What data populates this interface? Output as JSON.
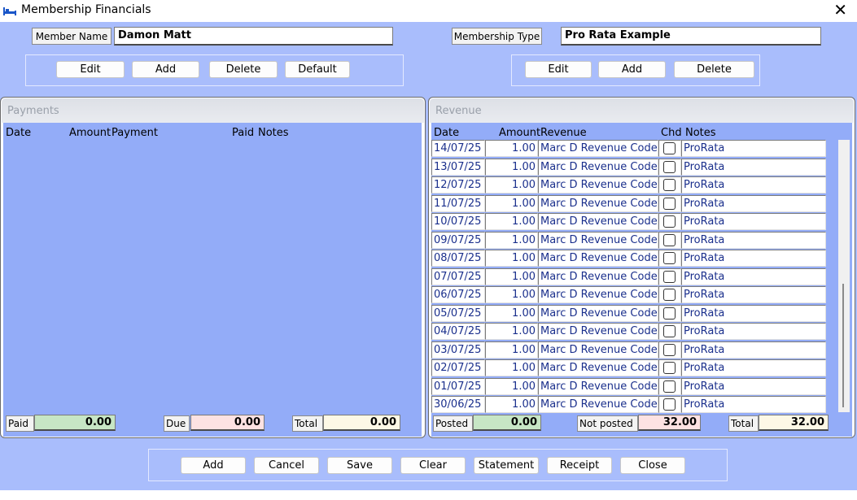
{
  "window": {
    "title": "Membership Financials",
    "icon": "bed-icon",
    "close_glyph": "✕"
  },
  "member": {
    "label": "Member Name",
    "value": "Damon Matt"
  },
  "membership_type": {
    "label": "Membership Type",
    "value": "Pro Rata Example"
  },
  "member_buttons": [
    "Edit",
    "Add",
    "Delete",
    "Default"
  ],
  "type_buttons": [
    "Edit",
    "Add",
    "Delete"
  ],
  "payments": {
    "title": "Payments",
    "columns": [
      "Date",
      "Amount",
      "Payment",
      "Paid",
      "Notes"
    ],
    "totals": {
      "paid_label": "Paid",
      "paid_value": "0.00",
      "due_label": "Due",
      "due_value": "0.00",
      "total_label": "Total",
      "total_value": "0.00"
    }
  },
  "revenue": {
    "title": "Revenue",
    "columns": [
      "Date",
      "Amount",
      "Revenue",
      "Chd",
      "Notes"
    ],
    "rows": [
      {
        "date": "14/07/25",
        "amount": "1.00",
        "revenue": "Marc D Revenue Code",
        "notes": "ProRata"
      },
      {
        "date": "13/07/25",
        "amount": "1.00",
        "revenue": "Marc D Revenue Code",
        "notes": "ProRata"
      },
      {
        "date": "12/07/25",
        "amount": "1.00",
        "revenue": "Marc D Revenue Code",
        "notes": "ProRata"
      },
      {
        "date": "11/07/25",
        "amount": "1.00",
        "revenue": "Marc D Revenue Code",
        "notes": "ProRata"
      },
      {
        "date": "10/07/25",
        "amount": "1.00",
        "revenue": "Marc D Revenue Code",
        "notes": "ProRata"
      },
      {
        "date": "09/07/25",
        "amount": "1.00",
        "revenue": "Marc D Revenue Code",
        "notes": "ProRata"
      },
      {
        "date": "08/07/25",
        "amount": "1.00",
        "revenue": "Marc D Revenue Code",
        "notes": "ProRata"
      },
      {
        "date": "07/07/25",
        "amount": "1.00",
        "revenue": "Marc D Revenue Code",
        "notes": "ProRata"
      },
      {
        "date": "06/07/25",
        "amount": "1.00",
        "revenue": "Marc D Revenue Code",
        "notes": "ProRata"
      },
      {
        "date": "05/07/25",
        "amount": "1.00",
        "revenue": "Marc D Revenue Code",
        "notes": "ProRata"
      },
      {
        "date": "04/07/25",
        "amount": "1.00",
        "revenue": "Marc D Revenue Code",
        "notes": "ProRata"
      },
      {
        "date": "03/07/25",
        "amount": "1.00",
        "revenue": "Marc D Revenue Code",
        "notes": "ProRata"
      },
      {
        "date": "02/07/25",
        "amount": "1.00",
        "revenue": "Marc D Revenue Code",
        "notes": "ProRata"
      },
      {
        "date": "01/07/25",
        "amount": "1.00",
        "revenue": "Marc D Revenue Code",
        "notes": "ProRata"
      },
      {
        "date": "30/06/25",
        "amount": "1.00",
        "revenue": "Marc D Revenue Code",
        "notes": "ProRata"
      }
    ],
    "totals": {
      "posted_label": "Posted",
      "posted_value": "0.00",
      "not_posted_label": "Not posted",
      "not_posted_value": "32.00",
      "total_label": "Total",
      "total_value": "32.00"
    }
  },
  "footer_buttons": [
    "Add",
    "Cancel",
    "Save",
    "Clear",
    "Statement",
    "Receipt",
    "Close"
  ],
  "colors": {
    "window_bg": "#a9bdfc",
    "grid_bg": "#93acf8",
    "paid_green": "#c7e6c5",
    "due_pink": "#fde2e2",
    "total_cream": "#fdf8e6",
    "cell_text": "#1a2f8c"
  }
}
